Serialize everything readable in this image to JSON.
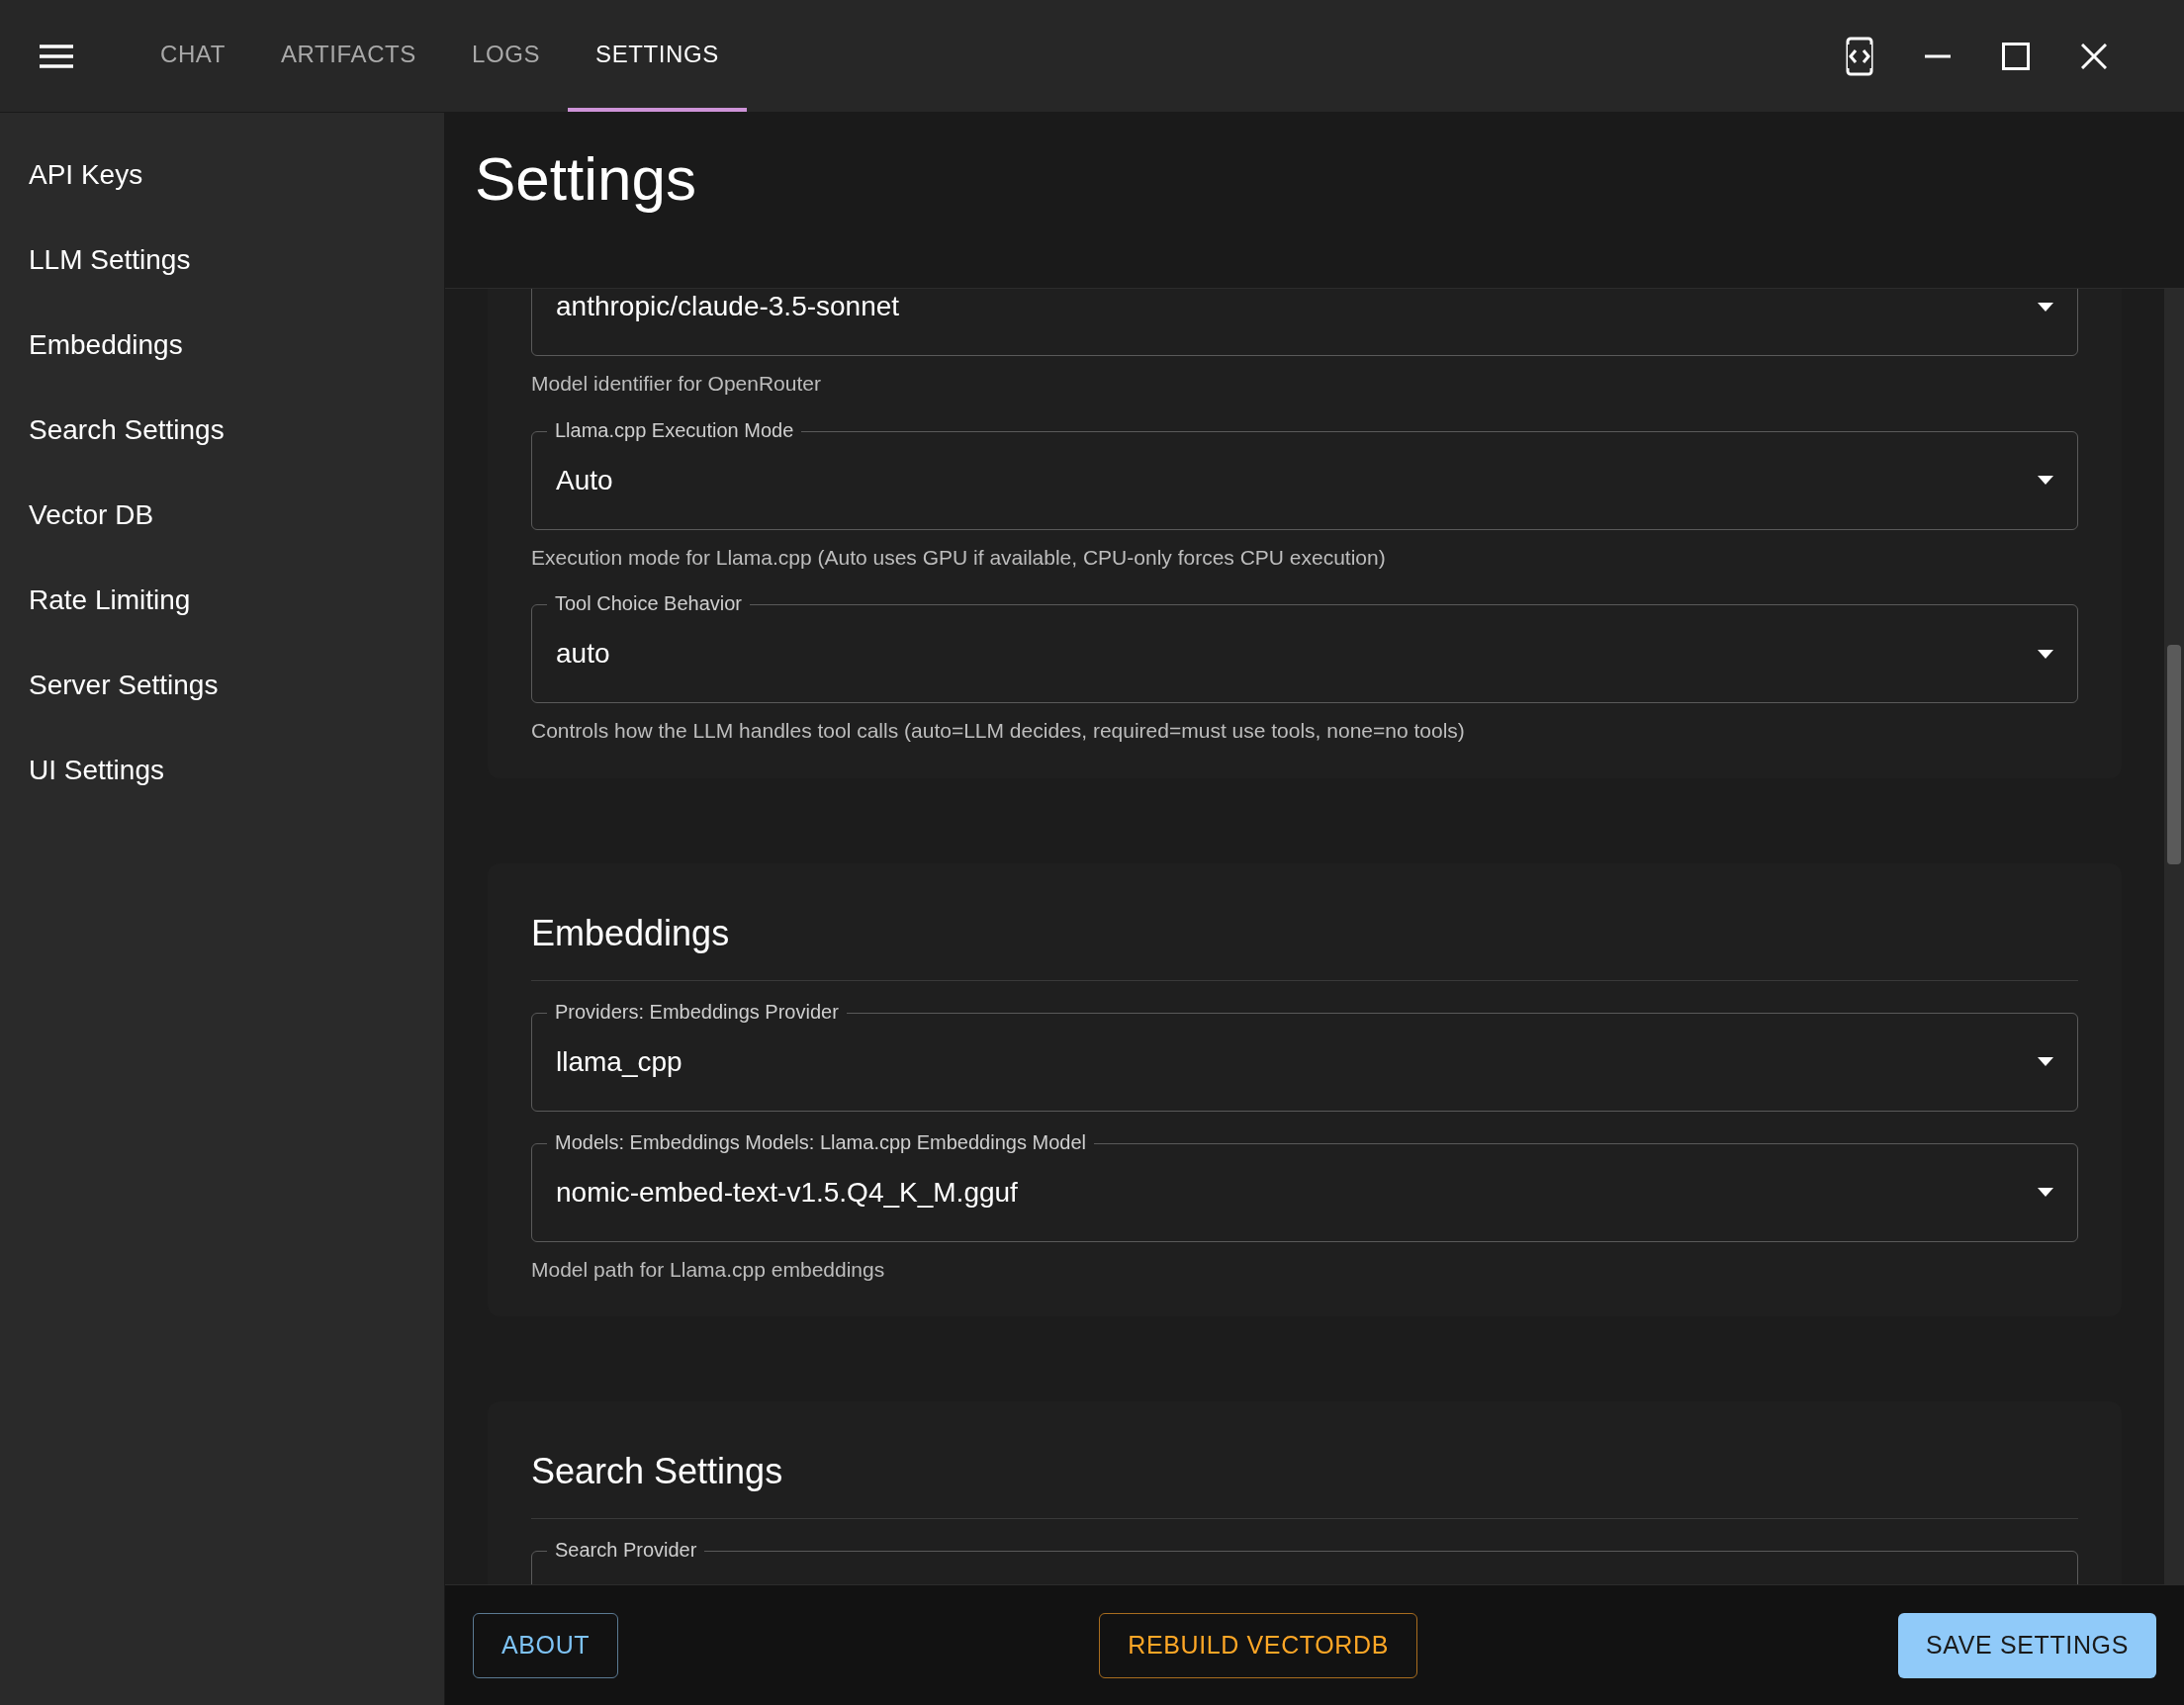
{
  "tabs": [
    {
      "label": "CHAT",
      "selected": false
    },
    {
      "label": "ARTIFACTS",
      "selected": false
    },
    {
      "label": "LOGS",
      "selected": false
    },
    {
      "label": "SETTINGS",
      "selected": true
    }
  ],
  "sidebar": {
    "items": [
      "API Keys",
      "LLM Settings",
      "Embeddings",
      "Search Settings",
      "Vector DB",
      "Rate Limiting",
      "Server Settings",
      "UI Settings"
    ]
  },
  "page_title": "Settings",
  "sections": [
    {
      "fields": [
        {
          "value": "anthropic/claude-3.5-sonnet",
          "helper": "Model identifier for OpenRouter"
        },
        {
          "label": "Llama.cpp Execution Mode",
          "value": "Auto",
          "helper": "Execution mode for Llama.cpp (Auto uses GPU if available, CPU-only forces CPU execution)"
        },
        {
          "label": "Tool Choice Behavior",
          "value": "auto",
          "helper": "Controls how the LLM handles tool calls (auto=LLM decides, required=must use tools, none=no tools)"
        }
      ]
    },
    {
      "title": "Embeddings",
      "fields": [
        {
          "label": "Providers: Embeddings Provider",
          "value": "llama_cpp"
        },
        {
          "label": "Models: Embeddings Models: Llama.cpp Embeddings Model",
          "value": "nomic-embed-text-v1.5.Q4_K_M.gguf",
          "helper": "Model path for Llama.cpp embeddings"
        }
      ]
    },
    {
      "title": "Search Settings",
      "fields": [
        {
          "label": "Search Provider"
        }
      ]
    }
  ],
  "footer_buttons": [
    {
      "label": "ABOUT",
      "kind": "outlined"
    },
    {
      "label": "REBUILD VECTORDB",
      "kind": "warning"
    },
    {
      "label": "SAVE SETTINGS",
      "kind": "contained"
    }
  ]
}
